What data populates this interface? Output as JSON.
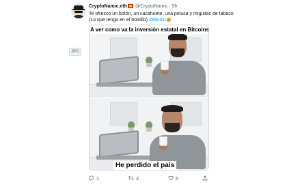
{
  "tweet": {
    "display_name": "CryptoNamic.eth",
    "handle": "@CryptoNamic",
    "separator": "·",
    "time": "5h",
    "text_line1": "Te ofrezco un botón, un cacahuete, una pelusa y miguitas de tabaco",
    "text_line2_prefix": "(Lo que tengo en el bolsillo) ",
    "hashtag": "#Bitcoin",
    "emojis": [
      "flag-icon",
      "bitcoin-emoji"
    ]
  },
  "media": {
    "badge": "JPG",
    "caption_top": "A ver como va la inversión estatal en Bitcoins",
    "caption_bottom": "He perdido el país"
  },
  "actions": {
    "reply_count": "1",
    "retweet_count": "3",
    "like_count": "6"
  },
  "colors": {
    "link": "#1d9bf0",
    "secondary_text": "#536471",
    "flag": "#d52b1e"
  }
}
